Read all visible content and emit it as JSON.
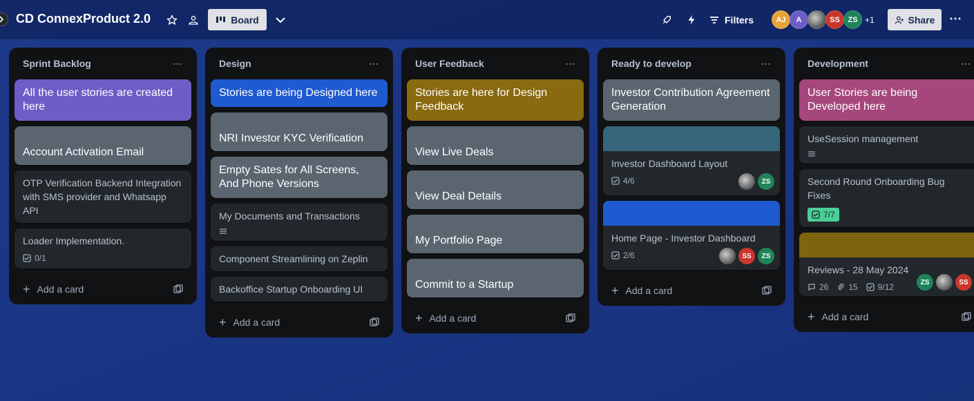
{
  "header": {
    "title": "CD ConnexProduct 2.0",
    "view_label": "Board",
    "filters_label": "Filters",
    "share_label": "Share",
    "more_members": "+1",
    "members": [
      {
        "initials": "AJ",
        "color": "#e8a23a"
      },
      {
        "initials": "A",
        "color": "#6e5dc6"
      },
      {
        "initials": "",
        "color": "#8a8f7a"
      },
      {
        "initials": "SS",
        "color": "#c9372c"
      },
      {
        "initials": "ZS",
        "color": "#1f845a"
      }
    ]
  },
  "lists": [
    {
      "title": "Sprint Backlog",
      "add_label": "Add a card",
      "cards": [
        {
          "title": "All the user stories are created here",
          "style": "big",
          "color": "#6e5dc6",
          "text_color": "#ffffff"
        },
        {
          "title": "Account Activation Email",
          "style": "big-tall",
          "color": "#5a6570",
          "text_color": "#ffffff"
        },
        {
          "title": "OTP Verification Backend Integration with SMS provider and Whatsapp API"
        },
        {
          "title": "Loader Implementation.",
          "checklist": "0/1"
        }
      ]
    },
    {
      "title": "Design",
      "add_label": "Add a card",
      "cards": [
        {
          "title": "Stories are being Designed here",
          "style": "big",
          "color": "#1f5bd0",
          "text_color": "#ffffff"
        },
        {
          "title": "NRI Investor KYC Verification",
          "style": "big-tall",
          "color": "#5a6570",
          "text_color": "#ffffff"
        },
        {
          "title": "Empty Sates for All Screens, And Phone Versions",
          "style": "big",
          "color": "#5a6570",
          "text_color": "#ffffff"
        },
        {
          "title": "My Documents and Transactions",
          "description": true
        },
        {
          "title": "Component Streamlining on Zeplin"
        },
        {
          "title": "Backoffice Startup Onboarding UI"
        }
      ]
    },
    {
      "title": "User Feedback",
      "add_label": "Add a card",
      "cards": [
        {
          "title": "Stories are here for Design Feedback",
          "style": "big",
          "color": "#8a6a10",
          "text_color": "#ffffff"
        },
        {
          "title": "View Live Deals",
          "style": "big-tall",
          "color": "#5a6570",
          "text_color": "#ffffff"
        },
        {
          "title": "View Deal Details",
          "style": "big-tall",
          "color": "#5a6570",
          "text_color": "#ffffff"
        },
        {
          "title": "My Portfolio Page",
          "style": "big-tall",
          "color": "#5a6570",
          "text_color": "#ffffff"
        },
        {
          "title": "Commit to a Startup",
          "style": "big-tall",
          "color": "#5a6570",
          "text_color": "#ffffff"
        }
      ]
    },
    {
      "title": "Ready to develop",
      "add_label": "Add a card",
      "cards": [
        {
          "title": "Investor Contribution Agreement Generation",
          "style": "big",
          "color": "#5a6570",
          "text_color": "#ffffff"
        },
        {
          "title": "Investor Dashboard Layout",
          "cover": "#35667a",
          "checklist": "4/6",
          "members": [
            "img",
            "ZS"
          ]
        },
        {
          "title": "Home Page - Investor Dashboard",
          "cover": "#1f5bd0",
          "checklist": "2/6",
          "members": [
            "img",
            "SS",
            "ZS"
          ]
        }
      ]
    },
    {
      "title": "Development",
      "add_label": "Add a card",
      "cards": [
        {
          "title": "User Stories are being Developed here",
          "style": "big",
          "color": "#a5477c",
          "text_color": "#ffffff"
        },
        {
          "title": "UseSession management",
          "description": true
        },
        {
          "title": "Second Round Onboarding Bug Fixes",
          "checklist_done": "7/7"
        },
        {
          "title": "Reviews - 28 May 2024",
          "cover": "#7f6410",
          "comments": "26",
          "attachments": "15",
          "checklist": "9/12",
          "members": [
            "ZS",
            "img",
            "SS"
          ]
        }
      ]
    }
  ]
}
